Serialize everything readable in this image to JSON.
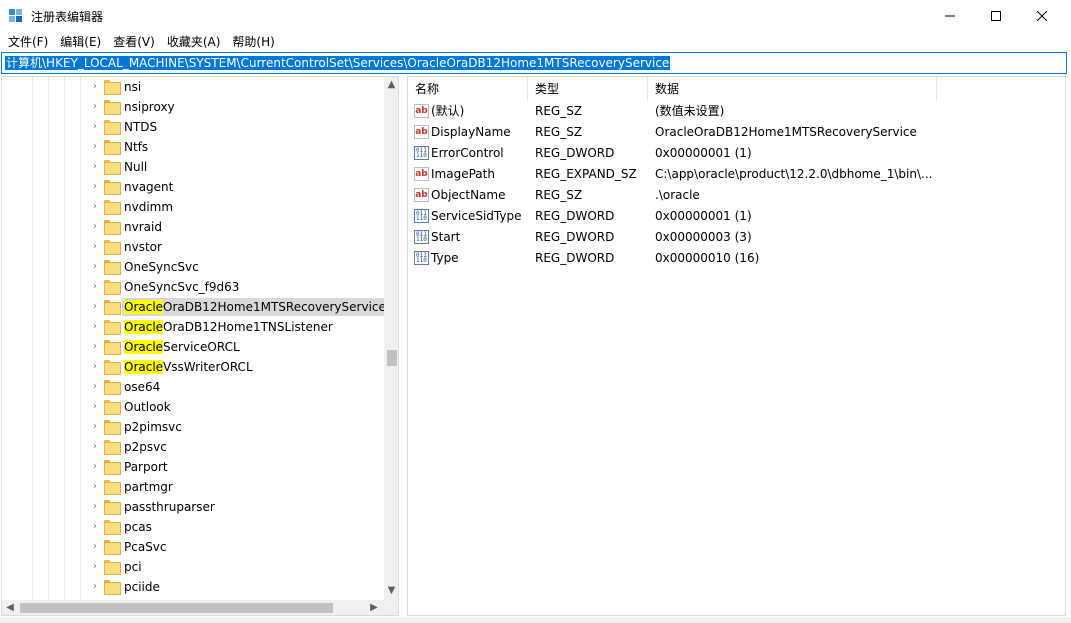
{
  "window": {
    "title": "注册表编辑器",
    "icon": "regedit-icon",
    "controls": {
      "minimize": "minimize-icon",
      "maximize": "maximize-icon",
      "close": "close-icon"
    }
  },
  "menu": [
    {
      "label": "文件(F)"
    },
    {
      "label": "编辑(E)"
    },
    {
      "label": "查看(V)"
    },
    {
      "label": "收藏夹(A)"
    },
    {
      "label": "帮助(H)"
    }
  ],
  "address": {
    "path": "计算机\\HKEY_LOCAL_MACHINE\\SYSTEM\\CurrentControlSet\\Services\\OracleOraDB12Home1MTSRecoveryService"
  },
  "tree": {
    "items": [
      {
        "label": "nsi"
      },
      {
        "label": "nsiproxy"
      },
      {
        "label": "NTDS"
      },
      {
        "label": "Ntfs"
      },
      {
        "label": "Null"
      },
      {
        "label": "nvagent"
      },
      {
        "label": "nvdimm"
      },
      {
        "label": "nvraid"
      },
      {
        "label": "nvstor"
      },
      {
        "label": "OneSyncSvc"
      },
      {
        "label": "OneSyncSvc_f9d63"
      },
      {
        "highlight": "Oracle",
        "rest": "OraDB12Home1MTSRecoveryService",
        "selected": true
      },
      {
        "highlight": "Oracle",
        "rest": "OraDB12Home1TNSListener"
      },
      {
        "highlight": "Oracle",
        "rest": "ServiceORCL"
      },
      {
        "highlight": "Oracle",
        "rest": "VssWriterORCL"
      },
      {
        "label": "ose64"
      },
      {
        "label": "Outlook"
      },
      {
        "label": "p2pimsvc"
      },
      {
        "label": "p2psvc"
      },
      {
        "label": "Parport"
      },
      {
        "label": "partmgr"
      },
      {
        "label": "passthruparser"
      },
      {
        "label": "pcas"
      },
      {
        "label": "PcaSvc"
      },
      {
        "label": "pci"
      },
      {
        "label": "pciide"
      }
    ]
  },
  "values": {
    "headers": {
      "name": "名称",
      "type": "类型",
      "data": "数据"
    },
    "rows": [
      {
        "icon": "string-value-icon",
        "name": "(默认)",
        "type": "REG_SZ",
        "data": "(数值未设置)"
      },
      {
        "icon": "string-value-icon",
        "name": "DisplayName",
        "type": "REG_SZ",
        "data": "OracleOraDB12Home1MTSRecoveryService"
      },
      {
        "icon": "binary-value-icon",
        "name": "ErrorControl",
        "type": "REG_DWORD",
        "data": "0x00000001 (1)"
      },
      {
        "icon": "string-value-icon",
        "name": "ImagePath",
        "type": "REG_EXPAND_SZ",
        "data": "C:\\app\\oracle\\product\\12.2.0\\dbhome_1\\bin\\..."
      },
      {
        "icon": "string-value-icon",
        "name": "ObjectName",
        "type": "REG_SZ",
        "data": ".\\oracle"
      },
      {
        "icon": "binary-value-icon",
        "name": "ServiceSidType",
        "type": "REG_DWORD",
        "data": "0x00000001 (1)"
      },
      {
        "icon": "binary-value-icon",
        "name": "Start",
        "type": "REG_DWORD",
        "data": "0x00000003 (3)"
      },
      {
        "icon": "binary-value-icon",
        "name": "Type",
        "type": "REG_DWORD",
        "data": "0x00000010 (16)"
      }
    ]
  },
  "colors": {
    "accent": "#0078d7",
    "highlight": "#ffff00",
    "selected_row": "#d9d9d9"
  }
}
